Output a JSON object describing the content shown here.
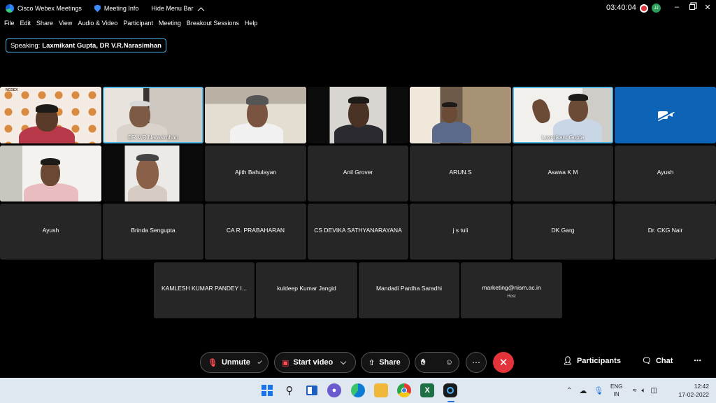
{
  "titlebar": {
    "app_name": "Cisco Webex Meetings",
    "meeting_info": "Meeting Info",
    "hide_menu_bar": "Hide Menu Bar",
    "clock": "03:40:04",
    "avatar_initials": "JJ"
  },
  "menu": [
    "File",
    "Edit",
    "Share",
    "View",
    "Audio & Video",
    "Participant",
    "Meeting",
    "Breakout Sessions",
    "Help"
  ],
  "speaking": {
    "label": "Speaking:",
    "names": "Laxmikant Gupta, DR V.R.Narasimhan"
  },
  "video_tiles": [
    {
      "name": ""
    },
    {
      "name": "DR V.R.Narasimhan"
    },
    {
      "name": ""
    },
    {
      "name": ""
    },
    {
      "name": ""
    },
    {
      "name": "Laxmikant Gupta"
    },
    {
      "name": ""
    },
    {
      "name": ""
    },
    {
      "name": ""
    }
  ],
  "name_tiles": [
    {
      "name": "Ajith Bahulayan",
      "host": ""
    },
    {
      "name": "Anil Grover",
      "host": ""
    },
    {
      "name": "ARUN.S",
      "host": ""
    },
    {
      "name": "Asawa K M",
      "host": ""
    },
    {
      "name": "Ayush",
      "host": ""
    },
    {
      "name": "Ayush",
      "host": ""
    },
    {
      "name": "Brinda Sengupta",
      "host": ""
    },
    {
      "name": "CA R. PRABAHARAN",
      "host": ""
    },
    {
      "name": "CS DEVIKA SATHYANARAYANA",
      "host": ""
    },
    {
      "name": "j s tuli",
      "host": ""
    },
    {
      "name": "DK Garg",
      "host": ""
    },
    {
      "name": "Dr. CKG Nair",
      "host": ""
    },
    {
      "name": "KAMLESH KUMAR PANDEY I...",
      "host": ""
    },
    {
      "name": "kuldeep Kumar Jangid",
      "host": ""
    },
    {
      "name": "Mandadi Pardha Saradhi",
      "host": ""
    },
    {
      "name": "marketing@nism.ac.in",
      "host": "Host"
    }
  ],
  "logo_text": "NCDEX",
  "toolbar": {
    "unmute": "Unmute",
    "start_video": "Start video",
    "share": "Share",
    "participants": "Participants",
    "chat": "Chat"
  },
  "taskbar": {
    "lang_top": "ENG",
    "lang_bottom": "IN",
    "time": "12:42",
    "date": "17-02-2022"
  },
  "colors": {
    "active_border": "#4fb8e6",
    "end_button": "#e3343c",
    "tile_bg": "#262626"
  }
}
